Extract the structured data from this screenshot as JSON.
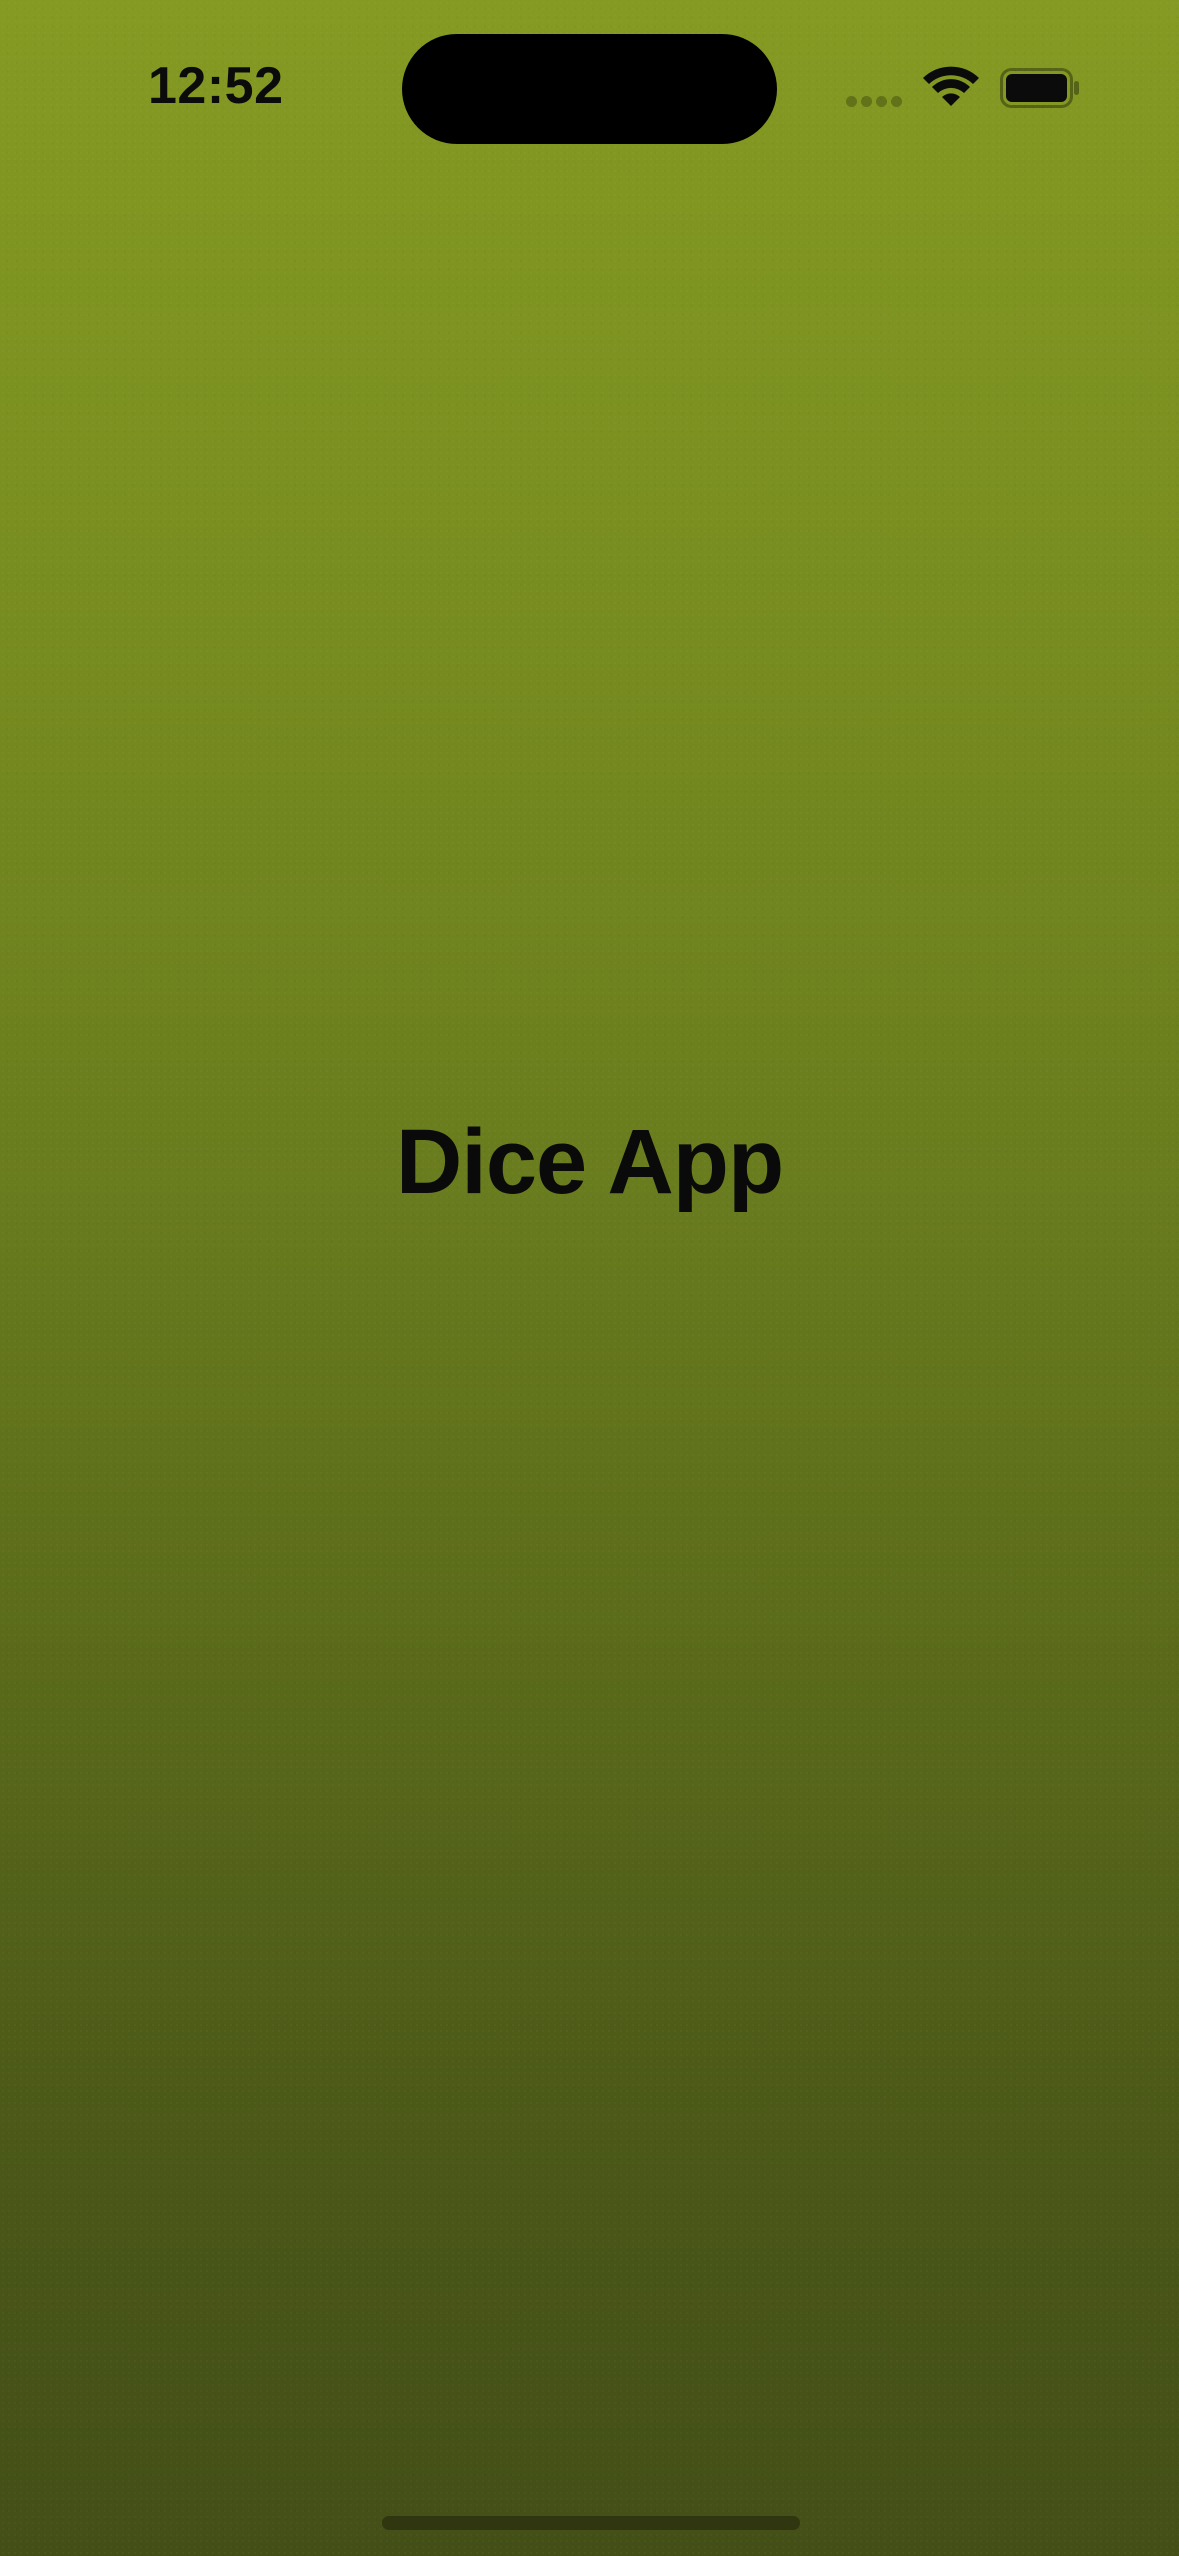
{
  "status_bar": {
    "time": "12:52"
  },
  "main": {
    "title": "Dice App"
  },
  "colors": {
    "background_top": "#849a22",
    "background_bottom": "#434f17",
    "text": "#0a0a0a"
  },
  "icons": {
    "signal": "cellular-signal-icon",
    "wifi": "wifi-icon",
    "battery": "battery-icon"
  }
}
